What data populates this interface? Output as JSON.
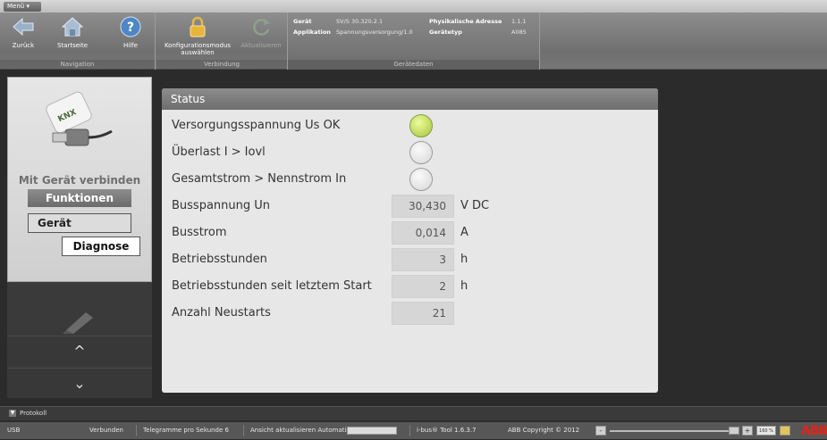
{
  "menu": {
    "label": "Menü ▾"
  },
  "ribbon": {
    "navigation": {
      "group_label": "Navigation",
      "back": "Zurück",
      "home": "Startseite",
      "help": "Hilfe"
    },
    "connection": {
      "group_label": "Verbindung",
      "config_line1": "Konfigurationsmodus",
      "config_line2": "auswählen",
      "refresh": "Aktualisieren"
    },
    "devicedata": {
      "group_label": "Gerätedaten",
      "device_key": "Gerät",
      "device_val": "SV/S 30.320.2.1",
      "app_key": "Applikation",
      "app_val": "Spannungsversorgung/1.0",
      "addr_key": "Physikalische Adresse",
      "addr_val": "1.1.1",
      "type_key": "Gerätetyp",
      "type_val": "A085"
    }
  },
  "left": {
    "connect": "Mit Gerät verbinden",
    "functions": "Funktionen",
    "device": "Gerät",
    "diagnose": "Diagnose",
    "up": "^",
    "down": "⌄"
  },
  "status": {
    "title": "Status",
    "rows": [
      {
        "label": "Versorgungsspannung Us OK",
        "kind": "led",
        "state": "on"
      },
      {
        "label": "Überlast I > Iovl",
        "kind": "led",
        "state": "off"
      },
      {
        "label": "Gesamtstrom > Nennstrom In",
        "kind": "led",
        "state": "off"
      },
      {
        "label": "Busspannung Un",
        "kind": "value",
        "value": "30,430",
        "unit": "V DC"
      },
      {
        "label": "Busstrom",
        "kind": "value",
        "value": "0,014",
        "unit": "A"
      },
      {
        "label": "Betriebsstunden",
        "kind": "value",
        "value": "3",
        "unit": "h"
      },
      {
        "label": "Betriebsstunden seit letztem Start",
        "kind": "value",
        "value": "2",
        "unit": "h"
      },
      {
        "label": "Anzahl Neustarts",
        "kind": "value",
        "value": "21",
        "unit": ""
      }
    ]
  },
  "protokoll": {
    "label": "Protokoll"
  },
  "statusbar": {
    "port": "USB",
    "connection": "Verbunden",
    "telegrams": "Telegramme pro Sekunde 6",
    "refresh": "Ansicht aktualisieren Automatisch",
    "tool": "i-bus® Tool 1.6.3.7",
    "copyright": "ABB Copyright © 2012",
    "zoom": "160 %",
    "minus": "-",
    "plus": "+",
    "logo": "ABB"
  }
}
